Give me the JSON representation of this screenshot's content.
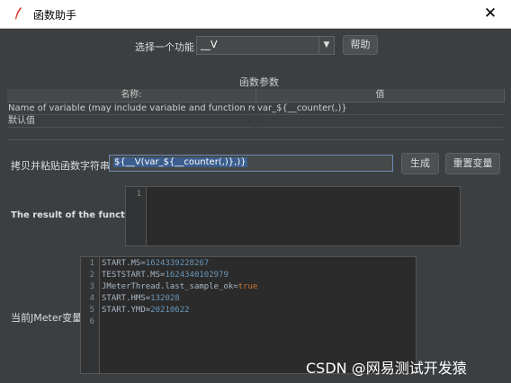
{
  "window": {
    "title": "函数助手",
    "close_glyph": "✕"
  },
  "function_selector": {
    "label": "选择一个功能",
    "value": "__V",
    "help_button": "帮助"
  },
  "params": {
    "section_title": "函数参数",
    "headers": [
      "名称:",
      "值"
    ],
    "rows": [
      {
        "name": "Name of variable (may include variable and function referenc...",
        "value": "var_${__counter(,)}"
      },
      {
        "name": "默认值",
        "value": ""
      }
    ]
  },
  "copy": {
    "label": "拷贝并粘贴函数字符串",
    "value": "${__V(var_${__counter(,)},)}",
    "generate_button": "生成",
    "reset_button": "重置变量"
  },
  "result": {
    "label": "The result of the function is",
    "line_numbers": [
      "1"
    ]
  },
  "jmeter_vars": {
    "label": "当前JMeter变量",
    "line_numbers": [
      "1",
      "2",
      "3",
      "4",
      "5",
      "6"
    ],
    "lines": [
      {
        "key": "START.MS=",
        "value": "1624339228267",
        "type": "number"
      },
      {
        "key": "TESTSTART.MS=",
        "value": "1624340102979",
        "type": "number"
      },
      {
        "key": "JMeterThread.last_sample_ok=",
        "value": "true",
        "type": "boolean"
      },
      {
        "key": "START.HMS=",
        "value": "132028",
        "type": "number"
      },
      {
        "key": "START.YMD=",
        "value": "20210622",
        "type": "number"
      }
    ]
  },
  "watermark": "CSDN @网易测试开发猿",
  "colors": {
    "background": "#3c3f41",
    "editor": "#2b2b2b",
    "number": "#6897bb",
    "boolean": "#cc7832",
    "selection": "#3b5e8e"
  },
  "icons": {
    "app": "feather-icon",
    "dropdown": "chevron-down-icon",
    "close": "close-icon"
  }
}
